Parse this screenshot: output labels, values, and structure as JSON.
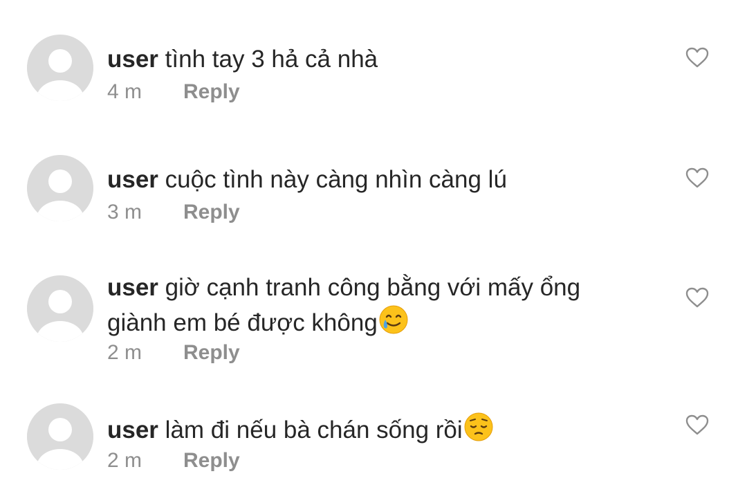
{
  "comments": [
    {
      "username": "user",
      "text": "tình tay 3 hả cả nhà",
      "emoji": "",
      "time": "4 m",
      "reply_label": "Reply"
    },
    {
      "username": "user",
      "text": "cuộc tình này càng nhìn càng lú",
      "emoji": "",
      "time": "3 m",
      "reply_label": "Reply"
    },
    {
      "username": "user",
      "text": "giờ cạnh tranh công bằng với mấy ổng giành em bé được không",
      "emoji": "smiling-face-with-tear",
      "time": "2 m",
      "reply_label": "Reply"
    },
    {
      "username": "user",
      "text": "làm đi nếu bà chán sống rồi",
      "emoji": "pensive-face",
      "time": "2 m",
      "reply_label": "Reply"
    }
  ],
  "colors": {
    "text": "#262626",
    "secondary": "#8e8e8e",
    "avatar_bg": "#dbdbdb",
    "avatar_fg": "#ffffff",
    "emoji_yellow": "#fcc21b",
    "tear_blue": "#4fa3e0"
  }
}
